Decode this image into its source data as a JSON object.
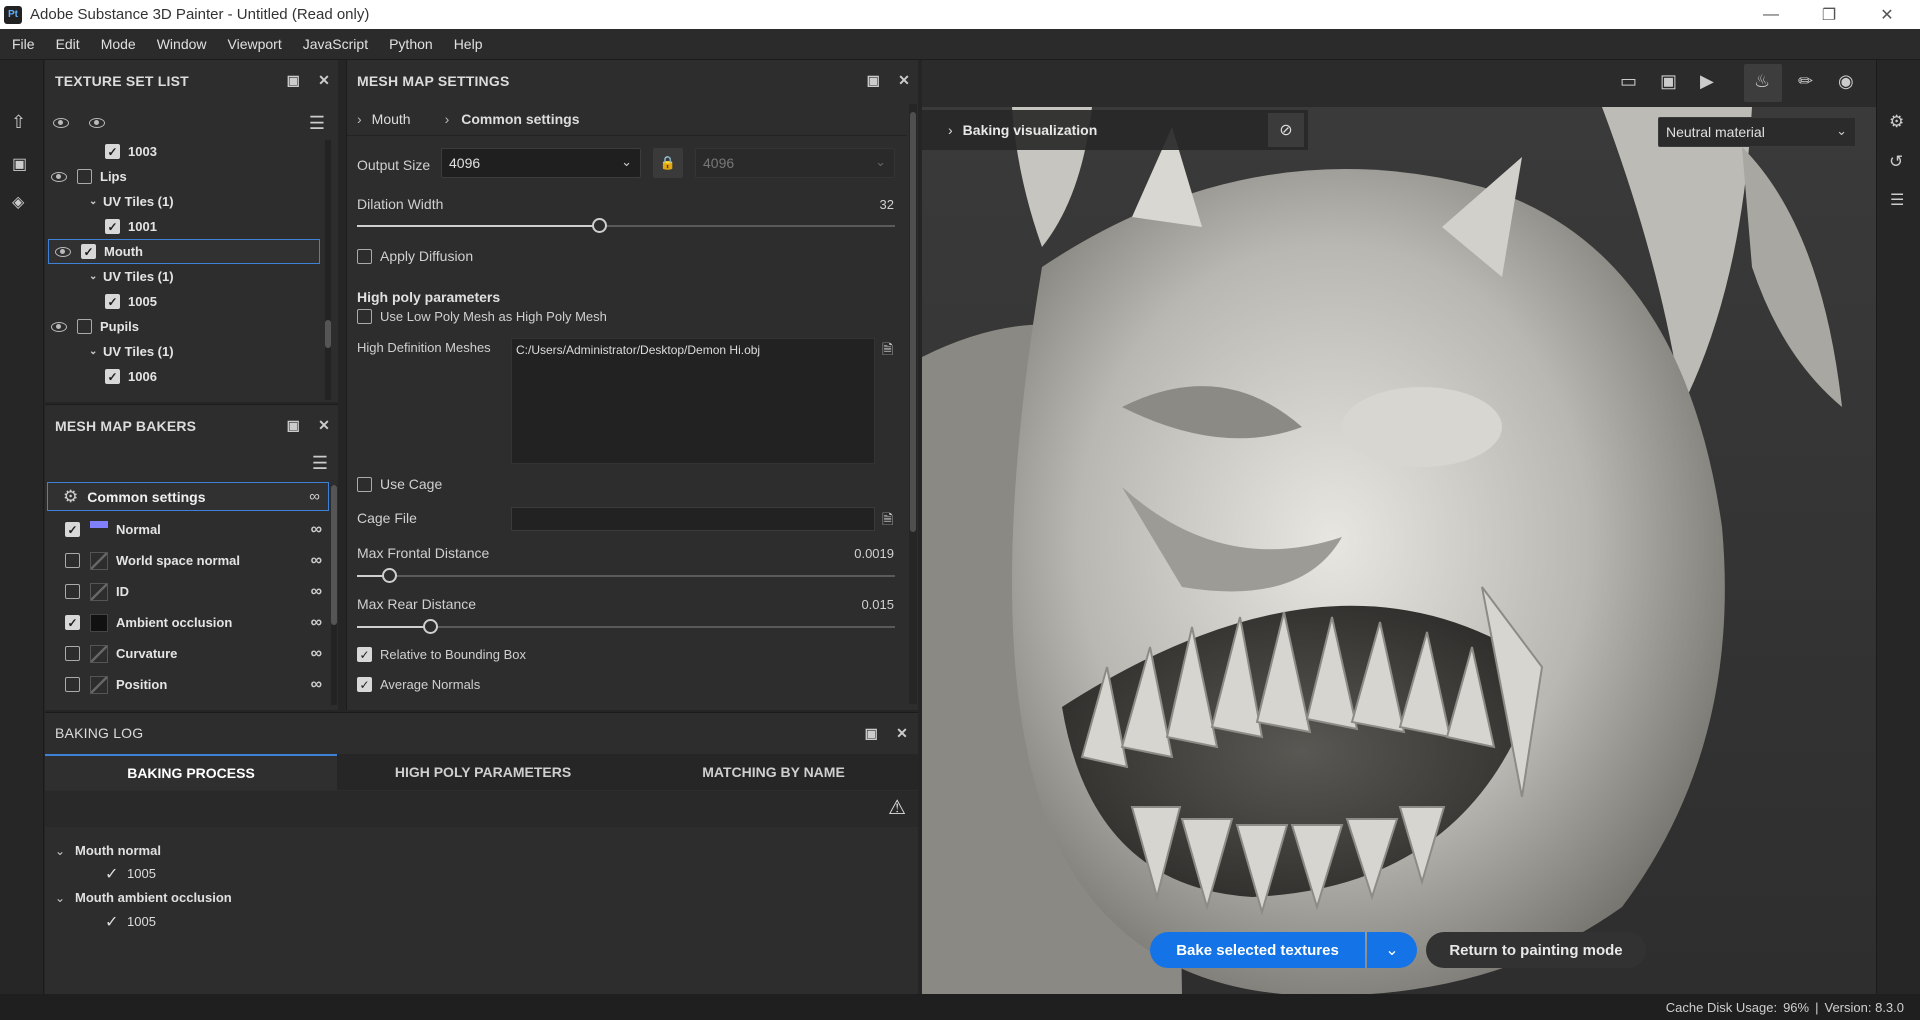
{
  "app": {
    "title": "Adobe Substance 3D Painter - Untitled (Read only)",
    "logo": "Pt"
  },
  "menu": [
    "File",
    "Edit",
    "Mode",
    "Window",
    "Viewport",
    "JavaScript",
    "Python",
    "Help"
  ],
  "texture_set_list": {
    "title": "TEXTURE SET LIST",
    "rows": [
      {
        "label": "1003",
        "level": 2,
        "checked": true,
        "eye": false,
        "toggle": false
      },
      {
        "label": "Lips",
        "level": 0,
        "checked": false,
        "eye": true,
        "toggle": false
      },
      {
        "label": "UV Tiles (1)",
        "level": 1,
        "checked": null,
        "eye": false,
        "toggle": true
      },
      {
        "label": "1001",
        "level": 2,
        "checked": true,
        "eye": false,
        "toggle": false
      },
      {
        "label": "Mouth",
        "level": 0,
        "checked": true,
        "eye": true,
        "toggle": false,
        "selected": true
      },
      {
        "label": "UV Tiles (1)",
        "level": 1,
        "checked": null,
        "eye": false,
        "toggle": true
      },
      {
        "label": "1005",
        "level": 2,
        "checked": true,
        "eye": false,
        "toggle": false
      },
      {
        "label": "Pupils",
        "level": 0,
        "checked": false,
        "eye": true,
        "toggle": false
      },
      {
        "label": "UV Tiles (1)",
        "level": 1,
        "checked": null,
        "eye": false,
        "toggle": true
      },
      {
        "label": "1006",
        "level": 2,
        "checked": true,
        "eye": false,
        "toggle": false
      }
    ]
  },
  "mesh_map_bakers": {
    "title": "MESH MAP BAKERS",
    "common": "Common settings",
    "items": [
      {
        "label": "Normal",
        "checked": true,
        "thumb": "normal"
      },
      {
        "label": "World space normal",
        "checked": false,
        "thumb": "none"
      },
      {
        "label": "ID",
        "checked": false,
        "thumb": "none"
      },
      {
        "label": "Ambient occlusion",
        "checked": true,
        "thumb": "ao"
      },
      {
        "label": "Curvature",
        "checked": false,
        "thumb": "none"
      },
      {
        "label": "Position",
        "checked": false,
        "thumb": "none"
      }
    ]
  },
  "mesh_map_settings": {
    "title": "MESH MAP SETTINGS",
    "breadcrumb": [
      "Mouth",
      "Common settings"
    ],
    "output_size_label": "Output Size",
    "output_size_value": "4096",
    "output_size_locked_value": "4096",
    "dilation_label": "Dilation Width",
    "dilation_value": "32",
    "dilation_fraction": 0.45,
    "apply_diffusion": "Apply Diffusion",
    "high_poly_header": "High poly parameters",
    "use_low_poly": "Use Low Poly Mesh as High Poly Mesh",
    "hd_meshes_label": "High Definition Meshes",
    "hd_meshes_value": "C:/Users/Administrator/Desktop/Demon Hi.obj",
    "use_cage": "Use Cage",
    "cage_file": "Cage File",
    "max_frontal_label": "Max Frontal Distance",
    "max_frontal_value": "0.0019",
    "max_frontal_fraction": 0.06,
    "max_rear_label": "Max Rear Distance",
    "max_rear_value": "0.015",
    "max_rear_fraction": 0.135,
    "relative_bbox": "Relative to Bounding Box",
    "average_normals": "Average Normals"
  },
  "baking_log": {
    "title": "BAKING LOG",
    "tabs": [
      "BAKING PROCESS",
      "HIGH POLY PARAMETERS",
      "MATCHING BY NAME"
    ],
    "groups": [
      {
        "name": "Mouth normal",
        "items": [
          "1005"
        ]
      },
      {
        "name": "Mouth ambient occlusion",
        "items": [
          "1005"
        ]
      }
    ]
  },
  "viewport": {
    "baking_visualization": "Baking visualization",
    "material_select": "Neutral material",
    "bake_button": "Bake selected textures",
    "return_button": "Return to painting mode"
  },
  "status": {
    "cache_label": "Cache Disk Usage:",
    "cache_value": "96%",
    "separator": "|",
    "version": "Version: 8.3.0"
  },
  "colors": {
    "accent": "#1473e6",
    "panel": "#2d2d2d",
    "background": "#252525"
  }
}
